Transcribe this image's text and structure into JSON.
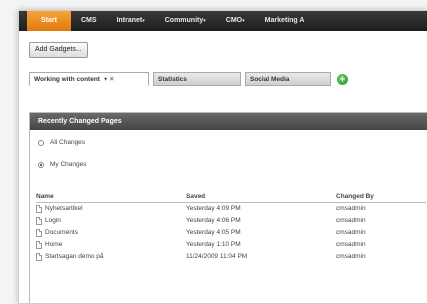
{
  "nav": {
    "items": [
      {
        "label": "Start",
        "arrow": ""
      },
      {
        "label": "CMS",
        "arrow": ""
      },
      {
        "label": "Intranet",
        "arrow": "▾"
      },
      {
        "label": "Community",
        "arrow": "▾"
      },
      {
        "label": "CMO",
        "arrow": "▾"
      },
      {
        "label": "Marketing A",
        "arrow": ""
      }
    ]
  },
  "toolbar": {
    "add_gadgets": "Add Gadgets..."
  },
  "tabs": [
    {
      "label": "Working with content",
      "controls": "▾ ✕"
    },
    {
      "label": "Statistics"
    },
    {
      "label": "Social Media"
    }
  ],
  "gadget": {
    "title": "Recently Changed Pages",
    "filters": [
      {
        "label": "All Changes",
        "checked": false
      },
      {
        "label": "My Changes",
        "checked": true
      }
    ],
    "columns": [
      "Name",
      "Saved",
      "Changed By"
    ],
    "rows": [
      {
        "name": "Nyhetsartikel",
        "saved": "Yesterday 4:09 PM",
        "by": "cmsadmin"
      },
      {
        "name": "Login",
        "saved": "Yesterday 4:06 PM",
        "by": "cmsadmin"
      },
      {
        "name": "Documents",
        "saved": "Yesterday 4:05 PM",
        "by": "cmsadmin"
      },
      {
        "name": "Home",
        "saved": "Yesterday 1:10 PM",
        "by": "cmsadmin"
      },
      {
        "name": "Startsagan demo på",
        "saved": "11/24/2009 11:04 PM",
        "by": "cmsadmin"
      }
    ]
  },
  "colors": {
    "accent": "#e8891f",
    "header": "#4f4f4f",
    "add_tab": "#2a9a2a"
  }
}
